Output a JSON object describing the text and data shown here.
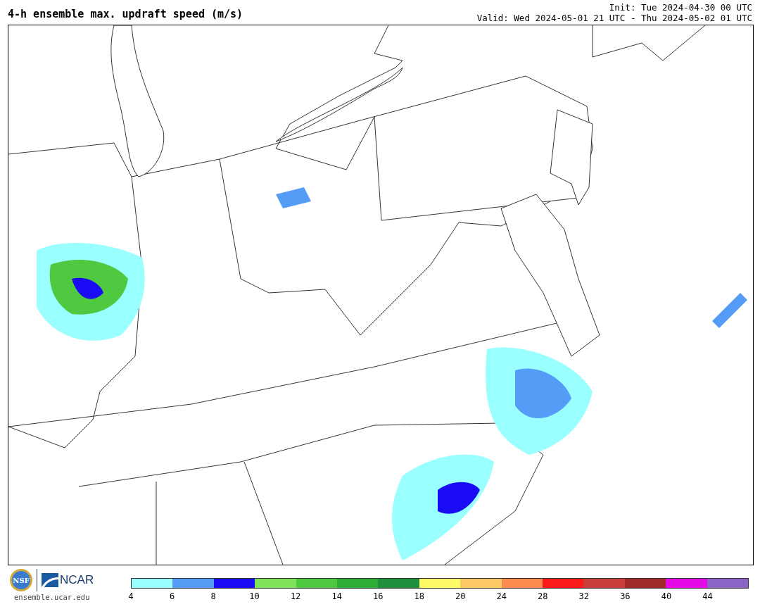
{
  "header": {
    "title": "4-h ensemble max. updraft speed (m/s)",
    "init": "Init: Tue 2024-04-30 00 UTC",
    "valid": "Valid: Wed 2024-05-01 21 UTC - Thu 2024-05-02 01 UTC"
  },
  "footer": {
    "nsf_logo": "NSF",
    "ncar_logo": "NCAR",
    "site": "ensemble.ucar.edu"
  },
  "colorbar": {
    "segments": [
      {
        "color": "#99ffff"
      },
      {
        "color": "#559cf7"
      },
      {
        "color": "#1a0bf5"
      },
      {
        "color": "#7ee25a"
      },
      {
        "color": "#4fc940"
      },
      {
        "color": "#2fac36"
      },
      {
        "color": "#1f8f3c"
      },
      {
        "color": "#fffb66"
      },
      {
        "color": "#fcc866"
      },
      {
        "color": "#fa8c50"
      },
      {
        "color": "#fa1a1a"
      },
      {
        "color": "#c83c3c"
      },
      {
        "color": "#a02a2a"
      },
      {
        "color": "#e60ae6"
      },
      {
        "color": "#8c64c8"
      }
    ],
    "ticks": [
      "4",
      "6",
      "8",
      "10",
      "12",
      "14",
      "16",
      "18",
      "20",
      "24",
      "28",
      "32",
      "36",
      "40",
      "44"
    ]
  }
}
